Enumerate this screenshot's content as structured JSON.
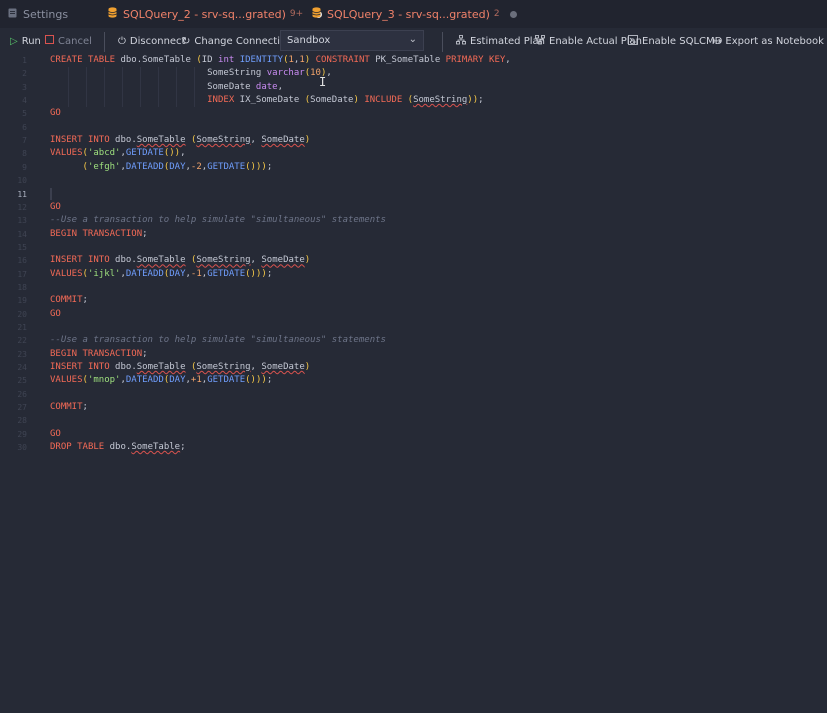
{
  "tabs": [
    {
      "label": "Settings"
    },
    {
      "label": "SQLQuery_2 - srv-sq...grated)",
      "badge": "9+"
    },
    {
      "label": "SQLQuery_3 - srv-sq...grated)",
      "badge": "2"
    }
  ],
  "toolbar": {
    "run": "Run",
    "cancel": "Cancel",
    "disconnect": "Disconnect",
    "change_connection": "Change Connection",
    "database": "Sandbox",
    "estimated_plan": "Estimated Plan",
    "actual_plan": "Enable Actual Plan",
    "sqlcmd": "Enable SQLCMD",
    "export": "Export as Notebook"
  },
  "colors": {
    "keyword": "#f36a56",
    "function": "#6f9dfc",
    "type": "#c98bf2",
    "string": "#9ee07e",
    "number": "#f3a46b",
    "comment": "#6d7488",
    "paren": "#f7c948",
    "tab_active": "#f0826a"
  },
  "editor": {
    "current_line": 11,
    "lines": [
      {
        "n": "1",
        "t": "CREATE TABLE dbo.SomeTable (ID int IDENTITY(1,1) CONSTRAINT PK_SomeTable PRIMARY KEY,"
      },
      {
        "n": "2",
        "t": "                             SomeString varchar(10),"
      },
      {
        "n": "3",
        "t": "                             SomeDate date,"
      },
      {
        "n": "4",
        "t": "                             INDEX IX_SomeDate (SomeDate) INCLUDE (SomeString));"
      },
      {
        "n": "5",
        "t": "GO"
      },
      {
        "n": "6",
        "t": ""
      },
      {
        "n": "7",
        "t": "INSERT INTO dbo.SomeTable (SomeString, SomeDate)"
      },
      {
        "n": "8",
        "t": "VALUES('abcd',GETDATE()),"
      },
      {
        "n": "9",
        "t": "      ('efgh',DATEADD(DAY,-2,GETDATE()));"
      },
      {
        "n": "10",
        "t": ""
      },
      {
        "n": "11",
        "t": ""
      },
      {
        "n": "12",
        "t": "GO"
      },
      {
        "n": "13",
        "t": "--Use a transaction to help simulate \"simultaneous\" statements"
      },
      {
        "n": "14",
        "t": "BEGIN TRANSACTION;"
      },
      {
        "n": "15",
        "t": ""
      },
      {
        "n": "16",
        "t": "INSERT INTO dbo.SomeTable (SomeString, SomeDate)"
      },
      {
        "n": "17",
        "t": "VALUES('ijkl',DATEADD(DAY,-1,GETDATE()));"
      },
      {
        "n": "18",
        "t": ""
      },
      {
        "n": "19",
        "t": "COMMIT;"
      },
      {
        "n": "20",
        "t": "GO"
      },
      {
        "n": "21",
        "t": ""
      },
      {
        "n": "22",
        "t": "--Use a transaction to help simulate \"simultaneous\" statements"
      },
      {
        "n": "23",
        "t": "BEGIN TRANSACTION;"
      },
      {
        "n": "24",
        "t": "INSERT INTO dbo.SomeTable (SomeString, SomeDate)"
      },
      {
        "n": "25",
        "t": "VALUES('mnop',DATEADD(DAY,+1,GETDATE()));"
      },
      {
        "n": "26",
        "t": ""
      },
      {
        "n": "27",
        "t": "COMMIT;"
      },
      {
        "n": "28",
        "t": ""
      },
      {
        "n": "29",
        "t": "GO"
      },
      {
        "n": "30",
        "t": "DROP TABLE dbo.SomeTable;"
      }
    ]
  }
}
